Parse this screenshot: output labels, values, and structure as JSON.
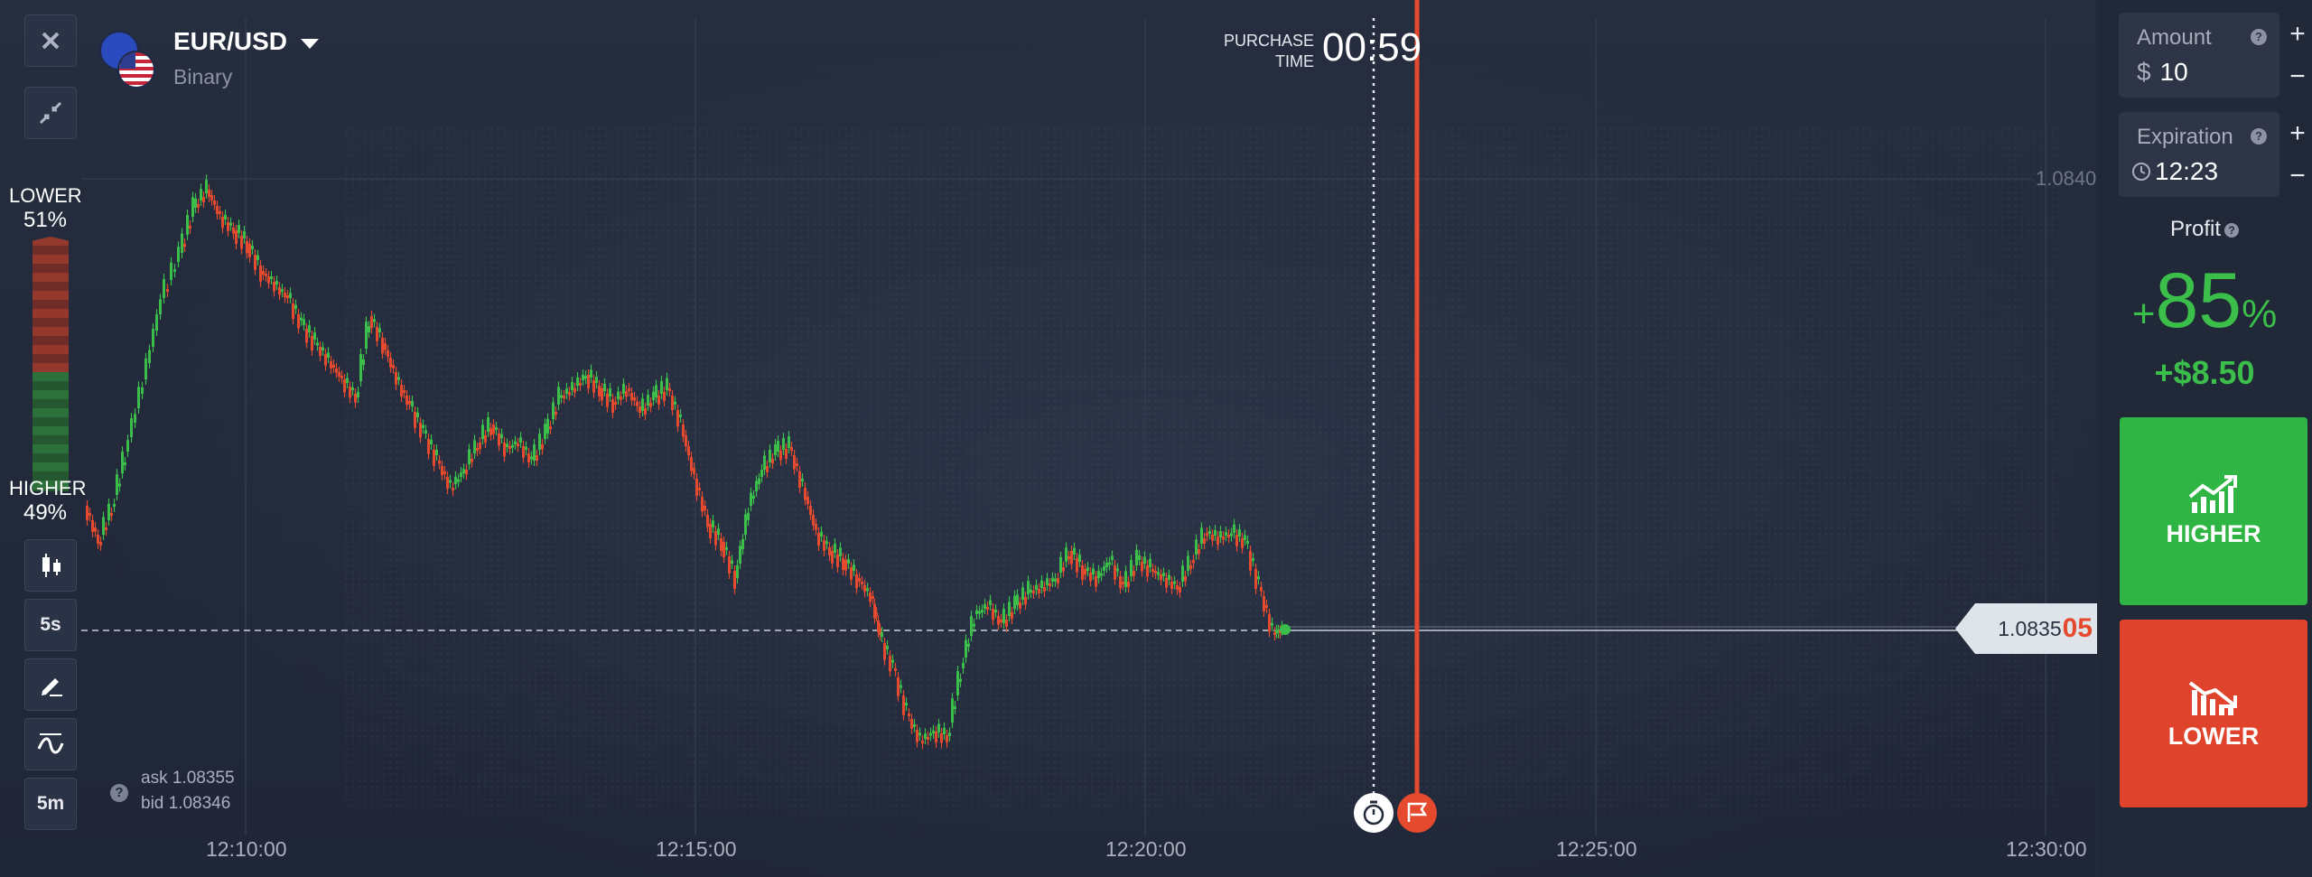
{
  "asset": {
    "name": "EUR/USD",
    "type": "Binary"
  },
  "tools": {
    "close_icon": "close-icon",
    "minimize_icon": "minimize-icon",
    "chart_type_icon": "candlestick-icon",
    "interval": "5s",
    "draw_icon": "pencil-icon",
    "indicator_icon": "indicator-icon",
    "zoom": "5m"
  },
  "sentiment": {
    "lower_label": "LOWER",
    "lower_pct": "51%",
    "higher_label": "HIGHER",
    "higher_pct": "49%"
  },
  "purchase": {
    "label_line1": "PURCHASE",
    "label_line2": "TIME",
    "countdown": "00:59"
  },
  "price": {
    "level_label": "1.0840",
    "current_main": "1.0835",
    "current_highlight": "05",
    "ask": "ask 1.08355",
    "bid": "bid 1.08346"
  },
  "time_axis": [
    "12:10:00",
    "12:15:00",
    "12:20:00",
    "12:25:00",
    "12:30:00"
  ],
  "panel": {
    "amount_label": "Amount",
    "amount_currency": "$",
    "amount_value": "10",
    "expiration_label": "Expiration",
    "expiration_value": "12:23",
    "plus": "+",
    "minus": "−",
    "profit_label": "Profit",
    "profit_percent_sign": "+",
    "profit_percent_value": "85",
    "profit_percent_unit": "%",
    "profit_amount": "+$8.50",
    "higher_label": "HIGHER",
    "lower_label": "LOWER"
  },
  "colors": {
    "green": "#3bbf4a",
    "red": "#e54a2f",
    "background": "#222a3b"
  }
}
